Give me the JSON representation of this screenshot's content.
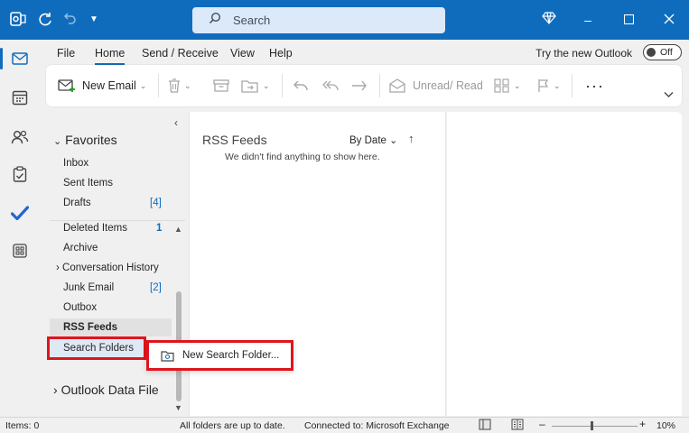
{
  "titlebar": {
    "search_placeholder": "Search",
    "colors": {
      "bar": "#0f6cbd",
      "search_bg": "#dbe9f8"
    }
  },
  "menu": {
    "tabs": [
      "File",
      "Home",
      "Send / Receive",
      "View",
      "Help"
    ],
    "active_tab": "Home",
    "try_new_label": "Try the new Outlook",
    "toggle_label": "Off"
  },
  "ribbon": {
    "new_email": "New Email",
    "unread_read": "Unread/ Read",
    "more": "···"
  },
  "folders": {
    "favorites_label": "Favorites",
    "favorites": [
      {
        "label": "Inbox",
        "count": ""
      },
      {
        "label": "Sent Items",
        "count": ""
      },
      {
        "label": "Drafts",
        "count": "[4]"
      }
    ],
    "items": [
      {
        "label": "Deleted Items",
        "count": "1"
      },
      {
        "label": "Archive",
        "count": ""
      },
      {
        "label": "Conversation History",
        "count": ""
      },
      {
        "label": "Junk Email",
        "count": "[2]"
      },
      {
        "label": "Outbox",
        "count": ""
      },
      {
        "label": "RSS Feeds",
        "count": ""
      },
      {
        "label": "Search Folders",
        "count": ""
      }
    ],
    "data_file": "Outlook Data File"
  },
  "message_list": {
    "title": "RSS Feeds",
    "sort_label": "By Date",
    "empty_text": "We didn't find anything to show here."
  },
  "context_menu": {
    "item": "New Search Folder..."
  },
  "status": {
    "items": "Items: 0",
    "sync": "All folders are up to date.",
    "connection": "Connected to: Microsoft Exchange",
    "zoom": "10%"
  },
  "highlight_color": "#e0141e"
}
